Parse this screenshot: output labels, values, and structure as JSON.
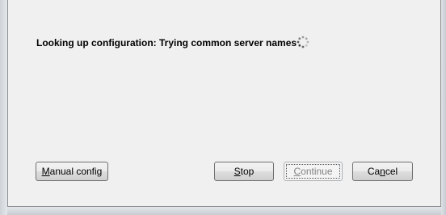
{
  "status": {
    "text": "Looking up configuration: Trying common server names"
  },
  "spinner": {
    "icon": "loading-spinner-icon"
  },
  "buttons": {
    "manual_config": {
      "mnemonic": "M",
      "rest": "anual config",
      "enabled": true
    },
    "stop": {
      "mnemonic": "S",
      "rest": "top",
      "enabled": true
    },
    "continue": {
      "pre": "",
      "mnemonic": "C",
      "rest": "ontinue",
      "enabled": false
    },
    "cancel": {
      "pre": "Ca",
      "mnemonic": "n",
      "rest": "cel",
      "enabled": true
    }
  }
}
